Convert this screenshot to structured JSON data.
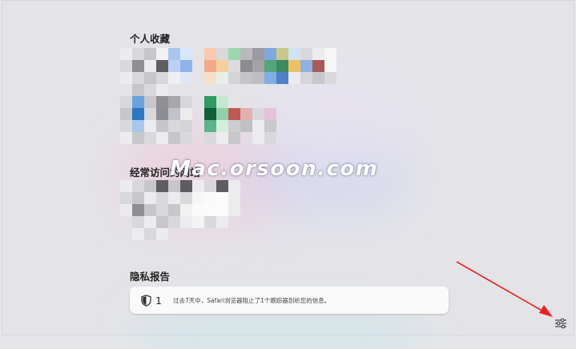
{
  "favorites": {
    "title": "个人收藏"
  },
  "frequent": {
    "title": "经常访问的网站"
  },
  "privacy_report": {
    "title": "隐私报告",
    "count": "1",
    "message": "过去7天中，Safari浏览器阻止了1个跟踪器剖析您的信息。"
  },
  "watermark": "Mac.orsoon.com",
  "icons": {
    "settings": "sliders-icon",
    "shield": "shield-icon",
    "arrow": "red-arrow-annotation"
  },
  "colors": {
    "annotation": "#e8211f",
    "background": "#e4e4e8"
  }
}
